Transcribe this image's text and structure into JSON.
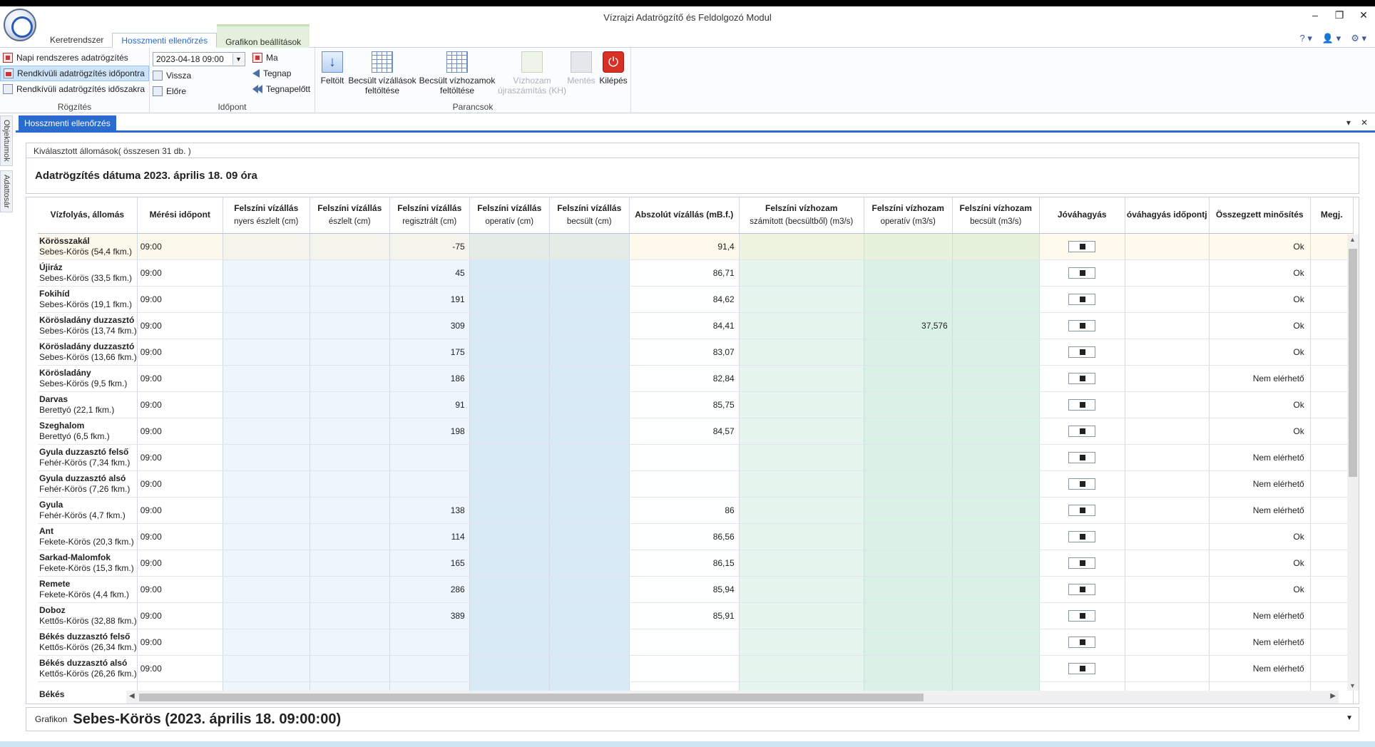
{
  "window": {
    "title": "Vízrajzi Adatrögzítő és Feldolgozó Modul",
    "controls": [
      "–",
      "❐",
      "✕"
    ],
    "help": [
      "? ▾",
      "👤 ▾",
      "⚙ ▾"
    ]
  },
  "ribbon_tabs": [
    {
      "label": "Keretrendszer"
    },
    {
      "label": "Hosszmenti ellenőrzés"
    },
    {
      "label": "Grafikon beállítások"
    }
  ],
  "ribbon": {
    "rogzites": {
      "label": "Rögzítés",
      "items": [
        "Napi rendszeres adatrögzítés",
        "Rendkívüli adatrögzítés időpontra",
        "Rendkívüli adatrögzítés időszakra"
      ]
    },
    "idopont": {
      "label": "Időpont",
      "date_value": "2023-04-18 09:00",
      "left_items": [
        "Vissza",
        "Előre"
      ],
      "right_items": [
        "Ma",
        "Tegnap",
        "Tegnapelőtt"
      ]
    },
    "parancsok": {
      "label": "Parancsok",
      "buttons": [
        {
          "line1": "Feltölt",
          "line2": ""
        },
        {
          "line1": "Becsült vízállások",
          "line2": "feltöltése"
        },
        {
          "line1": "Becsült vízhozamok",
          "line2": "feltöltése"
        },
        {
          "line1": "Vízhozam",
          "line2": "újraszámítás (KH)"
        },
        {
          "line1": "Mentés",
          "line2": ""
        },
        {
          "line1": "Kilépés",
          "line2": ""
        }
      ]
    }
  },
  "side_tabs": [
    "Objektumok",
    "Adattosár"
  ],
  "doc_tab": {
    "label": "Hosszmenti ellenőrzés",
    "controls": [
      "▾",
      "✕"
    ]
  },
  "selection_text": "Kiválasztott állomások( összesen 31 db. )",
  "date_header": "Adatrögzítés dátuma 2023. április 18. 09 óra",
  "columns": [
    {
      "title": "Vízfolyás, állomás",
      "sub": ""
    },
    {
      "title": "Mérési időpont",
      "sub": ""
    },
    {
      "title": "Felszíni vízállás",
      "sub": "nyers észlelt (cm)"
    },
    {
      "title": "Felszíni vízállás",
      "sub": "észlelt (cm)"
    },
    {
      "title": "Felszíni vízállás",
      "sub": "regisztrált (cm)"
    },
    {
      "title": "Felszíni vízállás",
      "sub": "operatív (cm)"
    },
    {
      "title": "Felszíni vízállás",
      "sub": "becsült (cm)"
    },
    {
      "title": "Abszolút vízállás (mB.f.)",
      "sub": ""
    },
    {
      "title": "Felszíni vízhozam",
      "sub": "számított (becsültből) (m3/s)"
    },
    {
      "title": "Felszíni vízhozam",
      "sub": "operatív (m3/s)"
    },
    {
      "title": "Felszíni vízhozam",
      "sub": "becsült (m3/s)"
    },
    {
      "title": "Jóváhagyás",
      "sub": ""
    },
    {
      "title": "óváhagyás időpontj",
      "sub": ""
    },
    {
      "title": "Összegzett minősítés",
      "sub": ""
    },
    {
      "title": "Megj.",
      "sub": ""
    }
  ],
  "rows": [
    {
      "name": "Körösszakál",
      "river": "Sebes-Körös (54,4 fkm.)",
      "time": "09:00",
      "reg": "-75",
      "abs": "91,4",
      "voper": "",
      "min": "Ok"
    },
    {
      "name": "Újiráz",
      "river": "Sebes-Körös (33,5 fkm.)",
      "time": "09:00",
      "reg": "45",
      "abs": "86,71",
      "voper": "",
      "min": "Ok"
    },
    {
      "name": "Fokihíd",
      "river": "Sebes-Körös (19,1 fkm.)",
      "time": "09:00",
      "reg": "191",
      "abs": "84,62",
      "voper": "",
      "min": "Ok"
    },
    {
      "name": "Körösladány duzzasztó",
      "river": "Sebes-Körös (13,74 fkm.)",
      "time": "09:00",
      "reg": "309",
      "abs": "84,41",
      "voper": "37,576",
      "min": "Ok"
    },
    {
      "name": "Körösladány duzzasztó",
      "river": "Sebes-Körös (13,66 fkm.)",
      "time": "09:00",
      "reg": "175",
      "abs": "83,07",
      "voper": "",
      "min": "Ok"
    },
    {
      "name": "Körösladány",
      "river": "Sebes-Körös (9,5 fkm.)",
      "time": "09:00",
      "reg": "186",
      "abs": "82,84",
      "voper": "",
      "min": "Nem elérhető"
    },
    {
      "name": "Darvas",
      "river": "Berettyó (22,1 fkm.)",
      "time": "09:00",
      "reg": "91",
      "abs": "85,75",
      "voper": "",
      "min": "Ok"
    },
    {
      "name": "Szeghalom",
      "river": "Berettyó (6,5 fkm.)",
      "time": "09:00",
      "reg": "198",
      "abs": "84,57",
      "voper": "",
      "min": "Ok"
    },
    {
      "name": "Gyula duzzasztó felső",
      "river": "Fehér-Körös (7,34 fkm.)",
      "time": "09:00",
      "reg": "",
      "abs": "",
      "voper": "",
      "min": "Nem elérhető"
    },
    {
      "name": "Gyula duzzasztó alsó",
      "river": "Fehér-Körös (7,26 fkm.)",
      "time": "09:00",
      "reg": "",
      "abs": "",
      "voper": "",
      "min": "Nem elérhető"
    },
    {
      "name": "Gyula",
      "river": "Fehér-Körös (4,7 fkm.)",
      "time": "09:00",
      "reg": "138",
      "abs": "86",
      "voper": "",
      "min": "Nem elérhető"
    },
    {
      "name": "Ant",
      "river": "Fekete-Körös (20,3 fkm.)",
      "time": "09:00",
      "reg": "114",
      "abs": "86,56",
      "voper": "",
      "min": "Ok"
    },
    {
      "name": "Sarkad-Malomfok",
      "river": "Fekete-Körös (15,3 fkm.)",
      "time": "09:00",
      "reg": "165",
      "abs": "86,15",
      "voper": "",
      "min": "Ok"
    },
    {
      "name": "Remete",
      "river": "Fekete-Körös (4,4 fkm.)",
      "time": "09:00",
      "reg": "286",
      "abs": "85,94",
      "voper": "",
      "min": "Ok"
    },
    {
      "name": "Doboz",
      "river": "Kettős-Körös (32,88 fkm.)",
      "time": "09:00",
      "reg": "389",
      "abs": "85,91",
      "voper": "",
      "min": "Nem elérhető"
    },
    {
      "name": "Békés duzzasztó felső",
      "river": "Kettős-Körös (26,34 fkm.)",
      "time": "09:00",
      "reg": "",
      "abs": "",
      "voper": "",
      "min": "Nem elérhető"
    },
    {
      "name": "Békés duzzasztó alsó",
      "river": "Kettős-Körös (26,26 fkm.)",
      "time": "09:00",
      "reg": "",
      "abs": "",
      "voper": "",
      "min": "Nem elérhető"
    },
    {
      "name": "Békés",
      "river": "",
      "time": "",
      "reg": "",
      "abs": "",
      "voper": "",
      "min": ""
    }
  ],
  "grafikon": {
    "label": "Grafikon",
    "title": "Sebes-Körös (2023. április 18. 09:00:00)"
  }
}
